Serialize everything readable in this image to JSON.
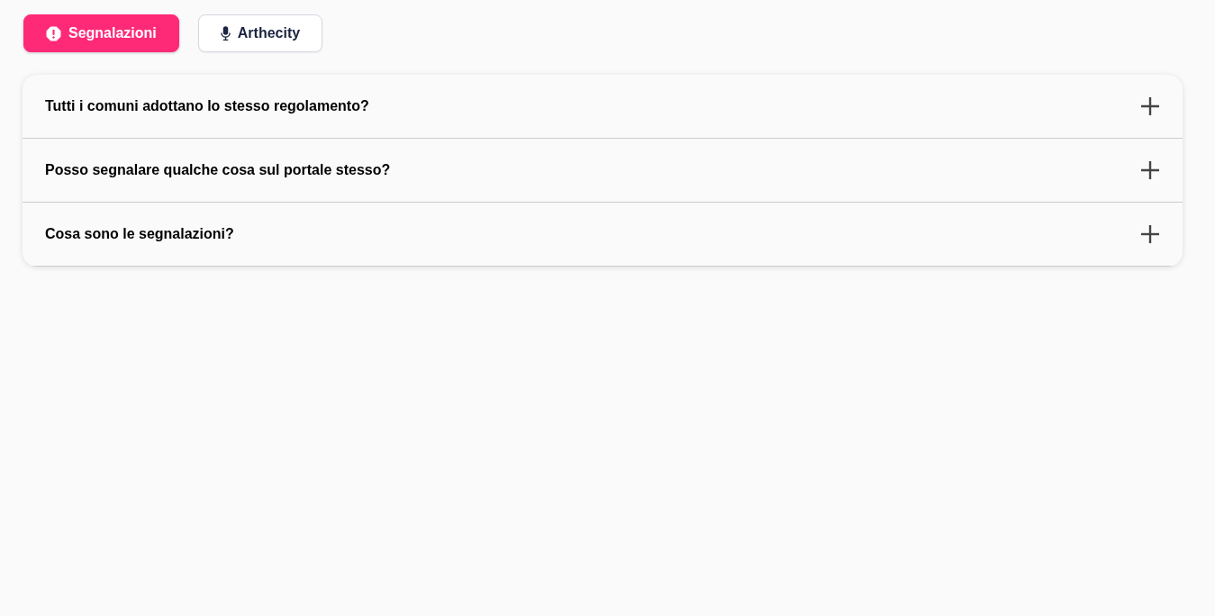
{
  "tabs": [
    {
      "label": "Segnalazioni",
      "selected": true
    },
    {
      "label": "Arthecity",
      "selected": false
    }
  ],
  "faq": [
    {
      "question": "Tutti i comuni adottano lo stesso regolamento?",
      "expanded": false
    },
    {
      "question": "Posso segnalare qualche cosa sul portale stesso?",
      "expanded": false
    },
    {
      "question": "Cosa sono le segnalazioni?",
      "expanded": false
    }
  ]
}
